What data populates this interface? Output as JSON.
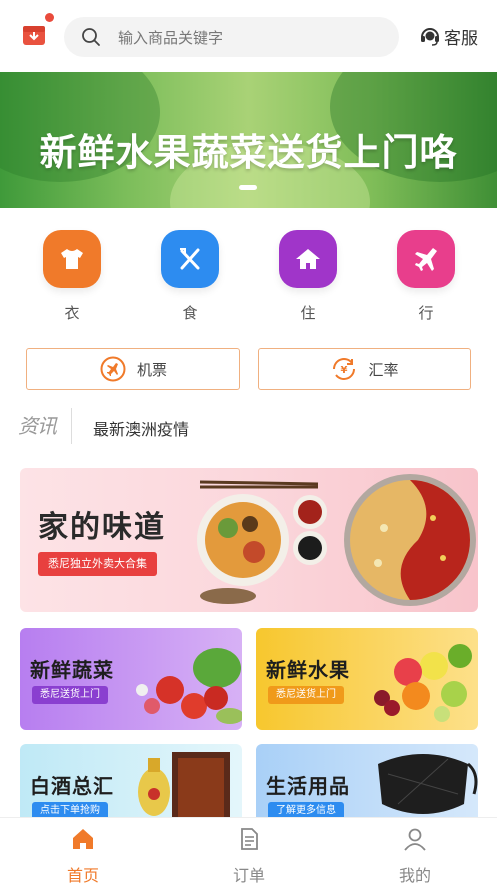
{
  "header": {
    "search_placeholder": "输入商品关键字",
    "service_label": "客服"
  },
  "banner": {
    "text": "新鲜水果蔬菜送货上门咯"
  },
  "categories": [
    {
      "label": "衣",
      "icon": "tshirt-icon",
      "color": "#f07a2a"
    },
    {
      "label": "食",
      "icon": "fork-knife-icon",
      "color": "#2d8cf0"
    },
    {
      "label": "住",
      "icon": "home-icon",
      "color": "#a035c9"
    },
    {
      "label": "行",
      "icon": "airplane-icon",
      "color": "#e83e8c"
    }
  ],
  "tools": [
    {
      "label": "机票",
      "icon": "plane-ticket-icon"
    },
    {
      "label": "汇率",
      "icon": "exchange-rate-icon"
    }
  ],
  "news": {
    "tag": "资讯",
    "headline": "最新澳洲疫情"
  },
  "promo": {
    "title": "家的味道",
    "pill": "悉尼独立外卖大合集"
  },
  "cards": [
    {
      "title": "新鲜蔬菜",
      "pill": "悉尼送货上门"
    },
    {
      "title": "新鲜水果",
      "pill": "悉尼送货上门"
    },
    {
      "title": "白酒总汇",
      "pill": "点击下单抢购"
    },
    {
      "title": "生活用品",
      "pill": "了解更多信息"
    }
  ],
  "tabbar": [
    {
      "label": "首页",
      "icon": "home-tab-icon",
      "active": true
    },
    {
      "label": "订单",
      "icon": "order-tab-icon",
      "active": false
    },
    {
      "label": "我的",
      "icon": "profile-tab-icon",
      "active": false
    }
  ],
  "colors": {
    "accent": "#f07a2a",
    "tool_border": "#f0b080",
    "promo_pill": "#e8403f"
  }
}
